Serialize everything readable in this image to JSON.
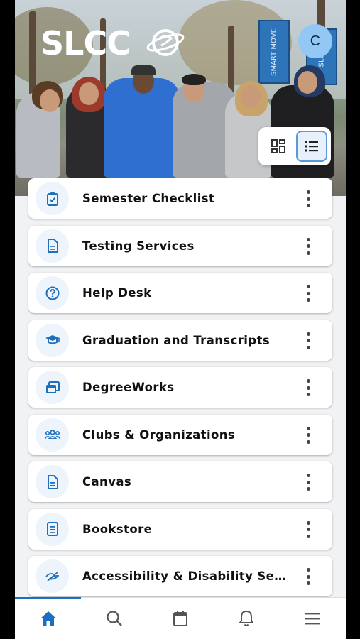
{
  "header": {
    "logo_text": "SLCC",
    "avatar_initial": "C",
    "banner_texts": [
      "SMART MOVE",
      "SLCC"
    ]
  },
  "view_toggle": {
    "options": [
      "grid-view",
      "list-view"
    ],
    "selected": "list-view"
  },
  "cards": [
    {
      "label": "Semester Checklist",
      "icon": "clipboard-check-icon"
    },
    {
      "label": "Testing Services",
      "icon": "document-icon"
    },
    {
      "label": "Help Desk",
      "icon": "help-circle-icon"
    },
    {
      "label": "Graduation and Transcripts",
      "icon": "graduation-cap-icon"
    },
    {
      "label": "DegreeWorks",
      "icon": "windows-icon"
    },
    {
      "label": "Clubs & Organizations",
      "icon": "group-icon"
    },
    {
      "label": "Canvas",
      "icon": "document-icon"
    },
    {
      "label": "Bookstore",
      "icon": "book-icon"
    },
    {
      "label": "Accessibility & Disability Servi...",
      "icon": "accessibility-icon"
    }
  ],
  "bottom_nav": {
    "items": [
      "home",
      "search",
      "calendar",
      "notifications",
      "menu"
    ],
    "active": "home"
  },
  "colors": {
    "accent": "#1a6fc4",
    "icon_blue": "#1f6fbf",
    "icon_bg": "#eef4fb",
    "avatar_bg": "#93c8f5"
  }
}
